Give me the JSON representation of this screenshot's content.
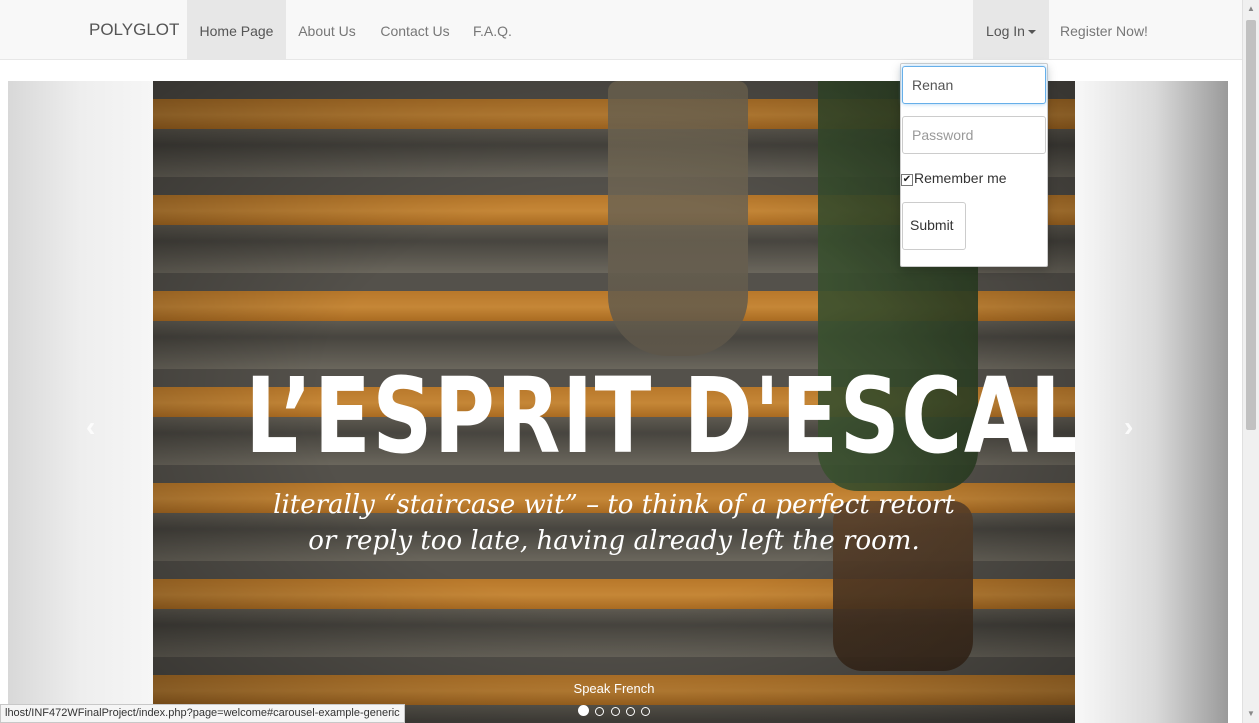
{
  "navbar": {
    "brand": "POLYGLOT",
    "links": [
      "Home Page",
      "About Us",
      "Contact Us",
      "F.A.Q."
    ],
    "login_label": "Log In",
    "register_label": "Register Now!"
  },
  "login_dropdown": {
    "username_value": "Renan",
    "password_placeholder": "Password",
    "remember_label": "Remember me",
    "remember_checked": true,
    "submit_label": "Submit"
  },
  "carousel": {
    "title": "L’ESPRIT D'ESCALIER",
    "subtitle_line1": "literally “staircase wit” – to think of a perfect retort",
    "subtitle_line2": "or reply too late, having already left the room.",
    "caption": "Speak French",
    "prev_glyph": "‹",
    "next_glyph": "›",
    "slide_count": 5,
    "active_slide": 1
  },
  "status_bar": {
    "url": "lhost/INF472WFinalProject/index.php?page=welcome#carousel-example-generic"
  }
}
